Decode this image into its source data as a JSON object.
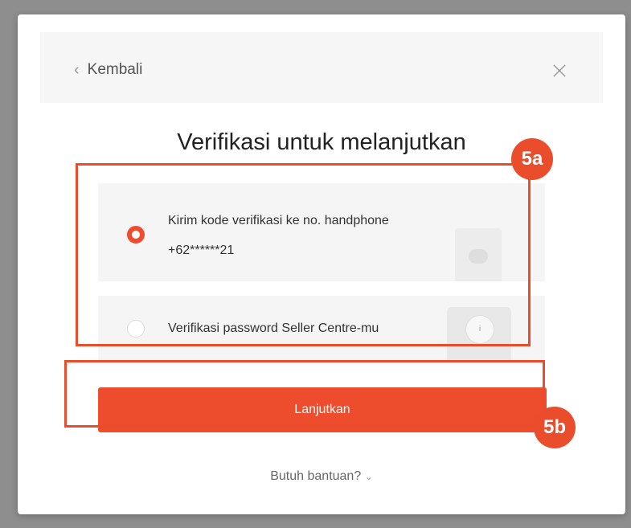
{
  "header": {
    "back_label": "Kembali",
    "back_icon": "chevron-left-icon",
    "close_icon": "close-icon"
  },
  "title": "Verifikasi untuk melanjutkan",
  "options": [
    {
      "label": "Kirim kode verifikasi ke no. handphone",
      "detail": "+62******21",
      "selected": true,
      "icon": "phone-message-icon"
    },
    {
      "label": "Verifikasi password Seller Centre-mu",
      "selected": false,
      "icon": "lock-dial-icon"
    }
  ],
  "continue_label": "Lanjutkan",
  "help_label": "Butuh bantuan?",
  "annotations": {
    "a": "5a",
    "b": "5b"
  },
  "colors": {
    "accent": "#ee4d2d",
    "annotation": "#ea4d2c",
    "overlay": "#8e8e8e"
  }
}
